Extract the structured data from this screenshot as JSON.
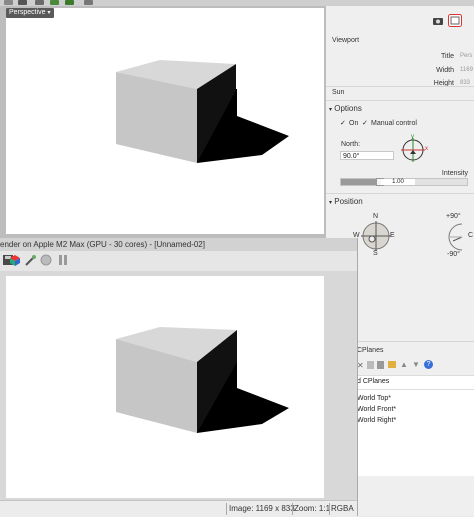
{
  "viewport": {
    "label": "Perspective"
  },
  "panel": {
    "viewport_heading": "Viewport",
    "title_label": "Title",
    "title_value": "Pers",
    "width_label": "Width",
    "width_value": "1169",
    "height_label": "Height",
    "height_value": "833",
    "sun_heading": "Sun",
    "options_heading": "Options",
    "on_label": "On",
    "manual_label": "Manual control",
    "north_label": "North:",
    "north_value": "90.0°",
    "intensity_label": "Intensity",
    "intensity_value": "1.00",
    "intensity_fraction": 0.28,
    "position_heading": "Position",
    "compass_n": "N",
    "compass_s": "S",
    "compass_e": "E",
    "compass_w": "W",
    "axis_y": "y",
    "axis_x": "x",
    "alt_max": "+90°",
    "alt_min": "-90°",
    "alt_c": "C",
    "cplanes_heading": "CPlanes",
    "cplanes_list_header": "d CPlanes",
    "cplanes_items": [
      "World Top*",
      "World Front*",
      "World Right*"
    ]
  },
  "render_window": {
    "title": "ender on Apple M2 Max (GPU - 30 cores) - [Unnamed-02]",
    "status_image": "Image: 1169 x 833",
    "status_zoom": "Zoom: 1:1",
    "status_format": "RGBA"
  },
  "colors": {
    "box_top": "#d8d8d8",
    "box_front": "#c6c6c6",
    "box_side": "#111111",
    "shadow": "#000000",
    "viewport_bg": "#ffffff"
  }
}
